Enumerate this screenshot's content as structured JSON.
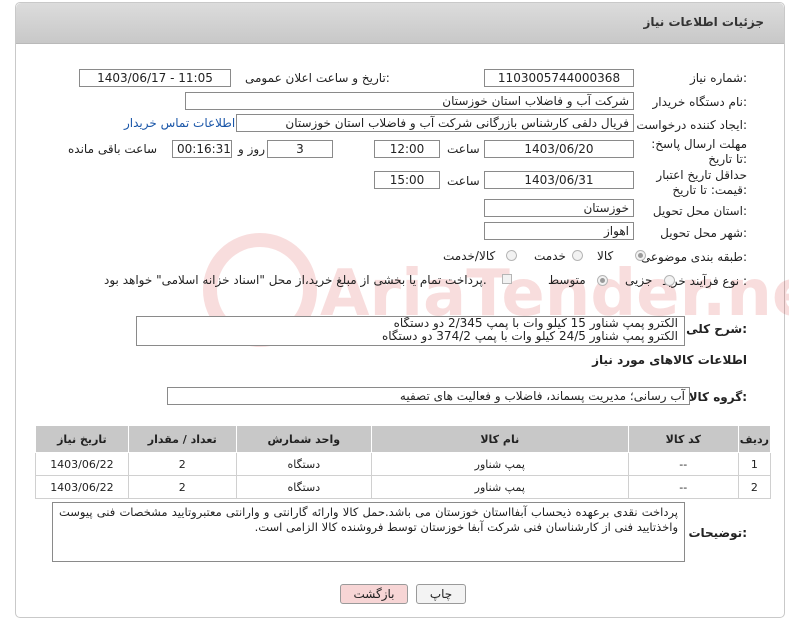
{
  "page": {
    "title": "جزئیات اطلاعات نیاز"
  },
  "fields": {
    "need_number_label": "شماره نیاز:",
    "need_number": "1103005744000368",
    "announce_label": "تاریخ و ساعت اعلان عمومی:",
    "announce_value": "1403/06/17 - 11:05",
    "buyer_org_label": "نام دستگاه خریدار:",
    "buyer_org": "شرکت آب و فاضلاب استان خوزستان",
    "requester_label": "ایجاد کننده درخواست:",
    "requester": "فریال دلفی کارشناس بازرگانی شرکت آب و فاضلاب استان خوزستان",
    "buyer_contact_link": "اطلاعات تماس خریدار",
    "deadline_label": "مهلت ارسال پاسخ: تا تاریخ:",
    "deadline_date": "1403/06/20",
    "time_label": "ساعت",
    "deadline_time": "12:00",
    "days_value": "3",
    "days_label": "روز و",
    "remaining_time": "00:16:31",
    "remaining_label": "ساعت باقی مانده",
    "validity_label": "حداقل تاریخ اعتبار قیمت: تا تاریخ:",
    "validity_date": "1403/06/31",
    "validity_time": "15:00",
    "delivery_province_label": "استان محل تحویل:",
    "delivery_province": "خوزستان",
    "delivery_city_label": "شهر محل تحویل:",
    "delivery_city": "اهواز",
    "category_label": "طبقه بندی موضوعی:",
    "category_options": [
      "کالا",
      "خدمت",
      "کالا/خدمت"
    ],
    "purchase_type_label": "نوع فرآیند خرید :",
    "purchase_options": [
      "جزیی",
      "متوسط"
    ],
    "payment_note": "پرداخت تمام یا بخشی از مبلغ خرید،از محل \"اسناد خزانه اسلامی\" خواهد بود.",
    "description_label": "شرح کلی نیاز:",
    "description_line1": "الکترو پمپ شناور 15 کیلو وات با پمپ 2/345 دو دستگاه",
    "description_line2": "الکترو پمپ شناور 24/5 کیلو وات با پمپ 374/2 دو دستگاه",
    "goods_info_title": "اطلاعات کالاهای مورد نیاز",
    "goods_group_label": "گروه کالا:",
    "goods_group": "آب رسانی؛ مدیریت پسماند، فاضلاب و فعالیت های تصفیه"
  },
  "table": {
    "headers": [
      "ردیف",
      "کد کالا",
      "نام کالا",
      "واحد شمارش",
      "تعداد / مقدار",
      "تاریخ نیاز"
    ],
    "rows": [
      [
        "1",
        "--",
        "پمپ شناور",
        "دستگاه",
        "2",
        "1403/06/22"
      ],
      [
        "2",
        "--",
        "پمپ شناور",
        "دستگاه",
        "2",
        "1403/06/22"
      ]
    ]
  },
  "buyer_notes": {
    "label": "توضیحات خریدار:",
    "text": "پرداخت نقدی برعهده ذیحساب آبفااستان خوزستان می باشد.حمل کالا وارائه گارانتی و وارانتی معتبروتایید مشخصات فنی پیوست واخذتایید فنی از کارشناسان فنی شرکت آبفا خوزستان توسط فروشنده کالا الزامی است."
  },
  "buttons": {
    "print": "چاپ",
    "back": "بازگشت"
  },
  "watermark": {
    "text": "AriaTender.net"
  },
  "colors": {
    "header_bg": "#c8c8c8",
    "link": "#1a56a8",
    "back_button": "#f7d5d5"
  }
}
